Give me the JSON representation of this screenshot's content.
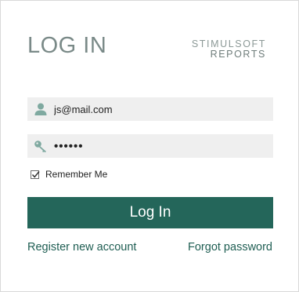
{
  "header": {
    "title": "LOG IN",
    "brand_line1": "STIMULSOFT",
    "brand_line2": "REPORTS"
  },
  "form": {
    "username": {
      "value": "js@mail.com",
      "icon": "user-icon"
    },
    "password": {
      "value": "••••••",
      "icon": "key-icon"
    },
    "remember": {
      "label": "Remember Me",
      "checked": true
    },
    "submit_label": "Log In"
  },
  "links": {
    "register": "Register new account",
    "forgot": "Forgot password"
  },
  "colors": {
    "accent": "#24665a",
    "icon": "#7fa9a0",
    "field_bg": "#efefef",
    "link": "#1f5e53"
  }
}
